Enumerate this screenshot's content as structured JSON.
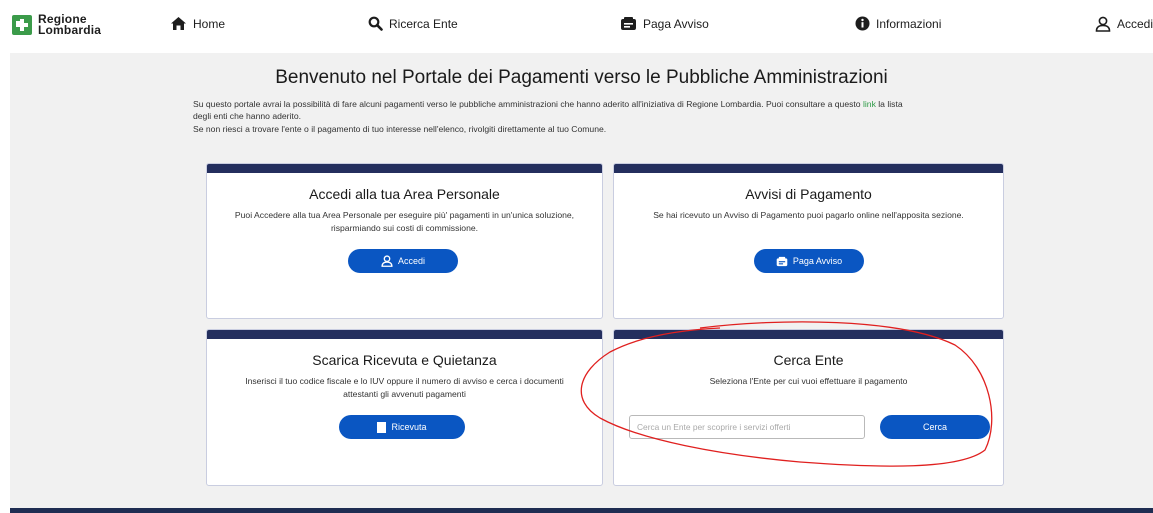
{
  "brand": {
    "line1": "Regione",
    "line2": "Lombardia",
    "color": "#3b9b4a"
  },
  "nav": {
    "home": "Home",
    "ricerca": "Ricerca Ente",
    "paga": "Paga Avviso",
    "info": "Informazioni",
    "accedi": "Accedi"
  },
  "page": {
    "title": "Benvenuto nel Portale dei Pagamenti verso le Pubbliche Amministrazioni",
    "intro_before_link": "Su questo portale avrai la possibilità di fare alcuni pagamenti verso le pubbliche amministrazioni che hanno aderito all'iniziativa di Regione Lombardia. Puoi consultare a questo ",
    "intro_link": "link",
    "intro_after_link": " la lista",
    "intro_line2": "degli enti che hanno aderito.",
    "intro_line3": "Se non riesci a trovare l'ente o il pagamento di tuo interesse nell'elenco, rivolgiti direttamente al tuo Comune."
  },
  "cards": {
    "area": {
      "title": "Accedi alla tua Area Personale",
      "desc1": "Puoi Accedere alla tua Area Personale per eseguire più' pagamenti in un'unica soluzione,",
      "desc2": "risparmiando sui costi di commissione.",
      "button": "Accedi"
    },
    "avvisi": {
      "title": "Avvisi di Pagamento",
      "desc1": "Se hai ricevuto un Avviso di Pagamento puoi pagarlo online nell'apposita sezione.",
      "button": "Paga Avviso"
    },
    "ricevuta": {
      "title": "Scarica Ricevuta e Quietanza",
      "desc1": "Inserisci il tuo codice fiscale e lo IUV oppure il numero di avviso e cerca i documenti",
      "desc2": "attestanti gli avvenuti pagamenti",
      "button": "Ricevuta"
    },
    "cerca": {
      "title": "Cerca Ente",
      "desc1": "Seleziona l'Ente per cui vuoi effettuare il pagamento",
      "placeholder": "Cerca un Ente per scoprire i servizi offerti",
      "button": "Cerca"
    }
  },
  "colors": {
    "accent_button": "#0a56c2",
    "card_header": "#242f5e",
    "link": "#2f9b48",
    "annotation": "#e0201f"
  }
}
